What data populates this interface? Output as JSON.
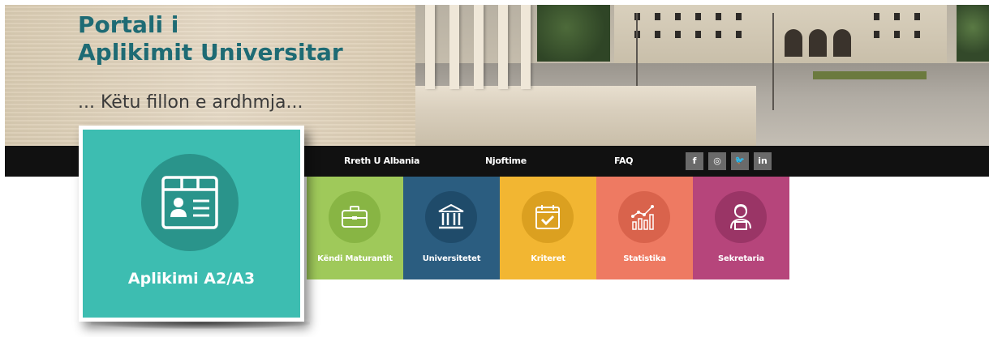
{
  "header": {
    "title_line1": "Portali i",
    "title_line2": "Aplikimit Universitar",
    "tagline": "... Këtu fillon e ardhmja..."
  },
  "nav": {
    "items": [
      {
        "label": "Rreth U Albania"
      },
      {
        "label": "Njoftime"
      },
      {
        "label": "FAQ"
      }
    ],
    "social": [
      {
        "label": "f",
        "icon": "facebook-icon"
      },
      {
        "label": "◎",
        "icon": "instagram-icon"
      },
      {
        "label": "🐦",
        "icon": "twitter-icon"
      },
      {
        "label": "in",
        "icon": "linkedin-icon"
      }
    ]
  },
  "tiles": [
    {
      "label": "Këndi Maturantit",
      "icon": "briefcase-icon",
      "color": "#9fc95a",
      "circle": "#88b544"
    },
    {
      "label": "Universitetet",
      "icon": "university-icon",
      "color": "#2b5d80",
      "circle": "#1f4b6a"
    },
    {
      "label": "Kriteret",
      "icon": "calendar-check-icon",
      "color": "#f2b632",
      "circle": "#dba020"
    },
    {
      "label": "Statistika",
      "icon": "chart-icon",
      "color": "#ee7a62",
      "circle": "#d9634c"
    },
    {
      "label": "Sekretaria",
      "icon": "secretary-icon",
      "color": "#b6457b",
      "circle": "#9a3566"
    }
  ],
  "featured": {
    "label": "Aplikimi A2/A3",
    "icon": "id-card-icon",
    "color": "#3dbdb1"
  }
}
